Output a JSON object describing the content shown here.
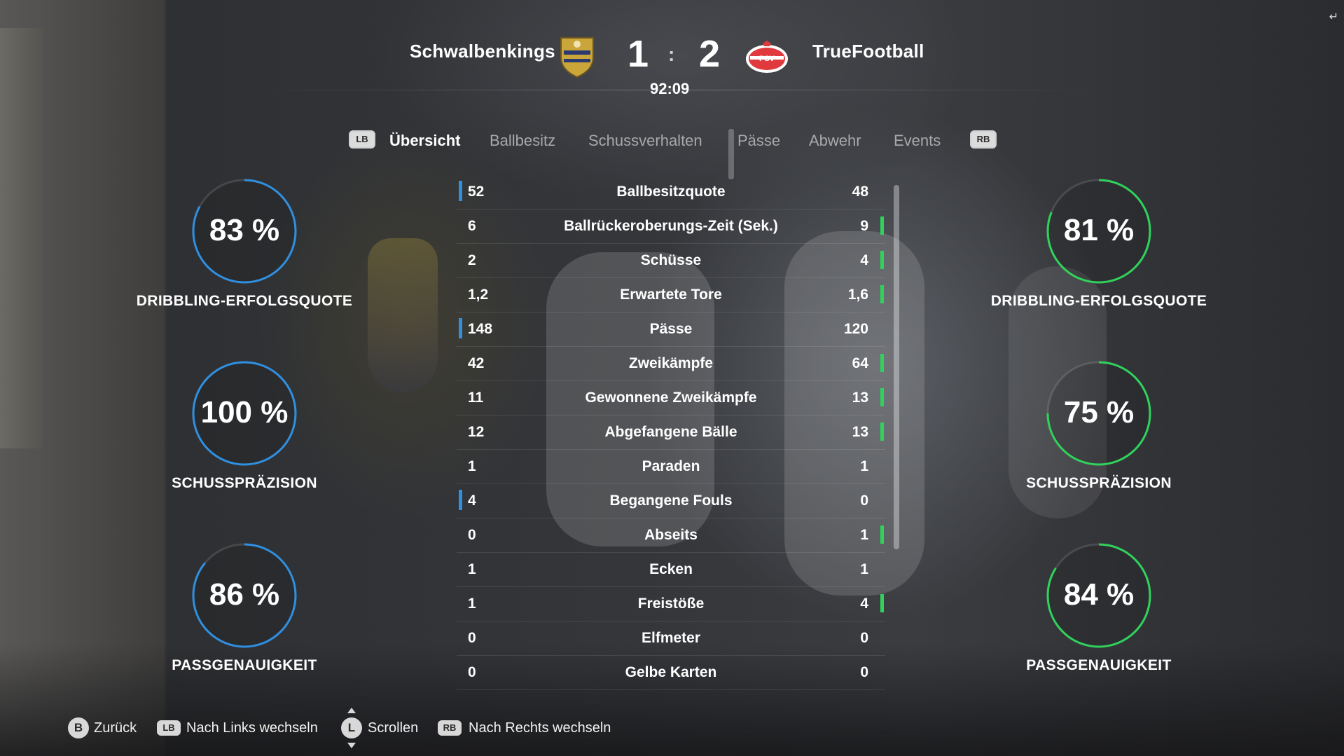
{
  "match": {
    "home_team": "Schwalbenkings",
    "away_team": "TrueFootball",
    "home_score": "1",
    "away_score": "2",
    "score_separator": ":",
    "clock": "92:09",
    "home_crest_icon": "shield-crest-icon",
    "away_crest_icon": "psv-crest-icon",
    "away_crest_text": "PSV"
  },
  "tabs": {
    "left_button": "LB",
    "right_button": "RB",
    "items": [
      "Übersicht",
      "Ballbesitz",
      "Schussverhalten",
      "Pässe",
      "Abwehr",
      "Events"
    ],
    "active": "Übersicht"
  },
  "stats": [
    {
      "label": "Ballbesitzquote",
      "home": "52",
      "away": "48",
      "leader": "home"
    },
    {
      "label": "Ballrückeroberungs-Zeit (Sek.)",
      "home": "6",
      "away": "9",
      "leader": "away"
    },
    {
      "label": "Schüsse",
      "home": "2",
      "away": "4",
      "leader": "away"
    },
    {
      "label": "Erwartete Tore",
      "home": "1,2",
      "away": "1,6",
      "leader": "away"
    },
    {
      "label": "Pässe",
      "home": "148",
      "away": "120",
      "leader": "home"
    },
    {
      "label": "Zweikämpfe",
      "home": "42",
      "away": "64",
      "leader": "away"
    },
    {
      "label": "Gewonnene Zweikämpfe",
      "home": "11",
      "away": "13",
      "leader": "away"
    },
    {
      "label": "Abgefangene Bälle",
      "home": "12",
      "away": "13",
      "leader": "away"
    },
    {
      "label": "Paraden",
      "home": "1",
      "away": "1",
      "leader": "none"
    },
    {
      "label": "Begangene Fouls",
      "home": "4",
      "away": "0",
      "leader": "home"
    },
    {
      "label": "Abseits",
      "home": "0",
      "away": "1",
      "leader": "away"
    },
    {
      "label": "Ecken",
      "home": "1",
      "away": "1",
      "leader": "none"
    },
    {
      "label": "Freistöße",
      "home": "1",
      "away": "4",
      "leader": "away"
    },
    {
      "label": "Elfmeter",
      "home": "0",
      "away": "0",
      "leader": "none"
    },
    {
      "label": "Gelbe Karten",
      "home": "0",
      "away": "0",
      "leader": "none"
    }
  ],
  "home_rings": [
    {
      "value": "83 %",
      "label": "DRIBBLING-ERFOLGSQUOTE",
      "fraction": 0.83
    },
    {
      "value": "100 %",
      "label": "SCHUSSPRÄZISION",
      "fraction": 1.0
    },
    {
      "value": "86 %",
      "label": "PASSGENAUIGKEIT",
      "fraction": 0.86
    }
  ],
  "away_rings": [
    {
      "value": "81 %",
      "label": "DRIBBLING-ERFOLGSQUOTE",
      "fraction": 0.81
    },
    {
      "value": "75 %",
      "label": "SCHUSSPRÄZISION",
      "fraction": 0.75
    },
    {
      "value": "84 %",
      "label": "PASSGENAUIGKEIT",
      "fraction": 0.84
    }
  ],
  "colors": {
    "home_accent": "#2f8fe0",
    "away_accent": "#2fd35b"
  },
  "footer": {
    "back_button": "B",
    "back_label": "Zurück",
    "left_button": "LB",
    "left_label": "Nach Links wechseln",
    "scroll_button": "L",
    "scroll_label": "Scrollen",
    "right_button": "RB",
    "right_label": "Nach Rechts wechseln"
  }
}
